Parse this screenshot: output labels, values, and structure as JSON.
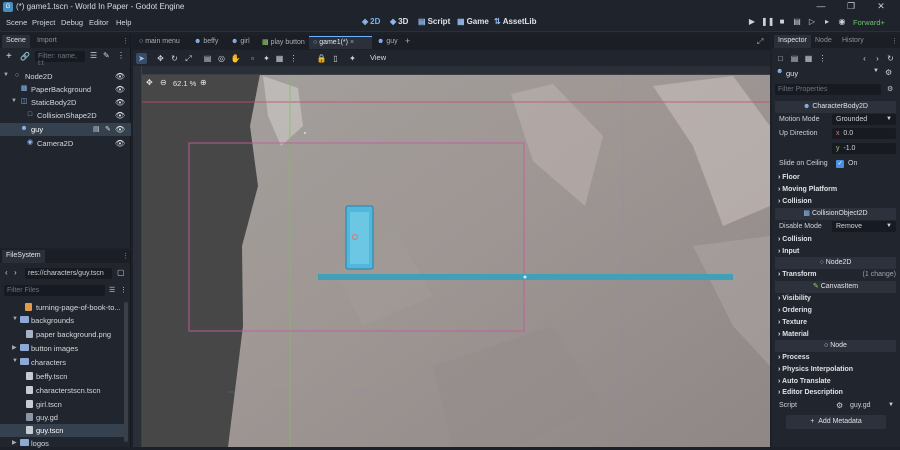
{
  "titlebar": {
    "title": "(*) game1.tscn - World In Paper - Godot Engine",
    "logo": "godot-icon"
  },
  "menu": {
    "items": [
      "Scene",
      "Project",
      "Debug",
      "Editor",
      "Help"
    ]
  },
  "workspaces": {
    "w2d": "2D",
    "w3d": "3D",
    "script": "Script",
    "game": "Game",
    "assetlib": "AssetLib"
  },
  "renderer": "Forward+",
  "scene_dock": {
    "tabs": [
      "Scene",
      "Import"
    ],
    "filter_placeholder": "Filter: name, t:t",
    "tree": [
      {
        "label": "Node2D",
        "icon": "node2d-icon"
      },
      {
        "label": "PaperBackground",
        "icon": "sprite2d-icon"
      },
      {
        "label": "StaticBody2D",
        "icon": "staticbody2d-icon"
      },
      {
        "label": "CollisionShape2D",
        "icon": "collisionshape2d-icon"
      },
      {
        "label": "guy",
        "icon": "characterbody2d-icon"
      },
      {
        "label": "Camera2D",
        "icon": "camera2d-icon"
      }
    ]
  },
  "filesystem": {
    "tab": "FileSystem",
    "path": "res://characters/guy.tscn",
    "filter_placeholder": "Filter Files",
    "items": [
      {
        "label": "turning-page-of-book-to...",
        "type": "file"
      },
      {
        "label": "backgrounds",
        "type": "folder"
      },
      {
        "label": "paper background.png",
        "type": "file"
      },
      {
        "label": "button images",
        "type": "folder"
      },
      {
        "label": "characters",
        "type": "folder"
      },
      {
        "label": "beffy.tscn",
        "type": "file"
      },
      {
        "label": "characterstscn.tscn",
        "type": "file"
      },
      {
        "label": "girl.tscn",
        "type": "file"
      },
      {
        "label": "guy.gd",
        "type": "file"
      },
      {
        "label": "guy.tscn",
        "type": "file"
      },
      {
        "label": "logos",
        "type": "folder"
      }
    ]
  },
  "scene_tabs": [
    "main menu",
    "beffy",
    "girl",
    "play button",
    "game1(*)",
    "guy"
  ],
  "viewport": {
    "zoom": "62.1 %",
    "view_menu": "View"
  },
  "inspector": {
    "tabs": [
      "Inspector",
      "Node",
      "History"
    ],
    "node_name": "guy",
    "filter_placeholder": "Filter Properties",
    "class_characterbody": "CharacterBody2D",
    "motion_mode_label": "Motion Mode",
    "motion_mode_value": "Grounded",
    "up_direction_label": "Up Direction",
    "up_x_label": "x",
    "up_x": "0.0",
    "up_y_label": "y",
    "up_y": "-1.0",
    "slide_label": "Slide on Ceiling",
    "slide_value": "On",
    "floor": "Floor",
    "moving_platform": "Moving Platform",
    "collision": "Collision",
    "class_collisionobject": "CollisionObject2D",
    "disable_mode_label": "Disable Mode",
    "disable_mode_value": "Remove",
    "collision2": "Collision",
    "input": "Input",
    "class_node2d": "Node2D",
    "transform": "Transform",
    "transform_changes": "(1 change)",
    "class_canvasitem": "CanvasItem",
    "visibility": "Visibility",
    "ordering": "Ordering",
    "texture": "Texture",
    "material": "Material",
    "class_node": "Node",
    "process": "Process",
    "physics_interp": "Physics Interpolation",
    "auto_translate": "Auto Translate",
    "editor_description": "Editor Description",
    "script_label": "Script",
    "script_value": "guy.gd",
    "add_metadata": "Add Metadata"
  }
}
